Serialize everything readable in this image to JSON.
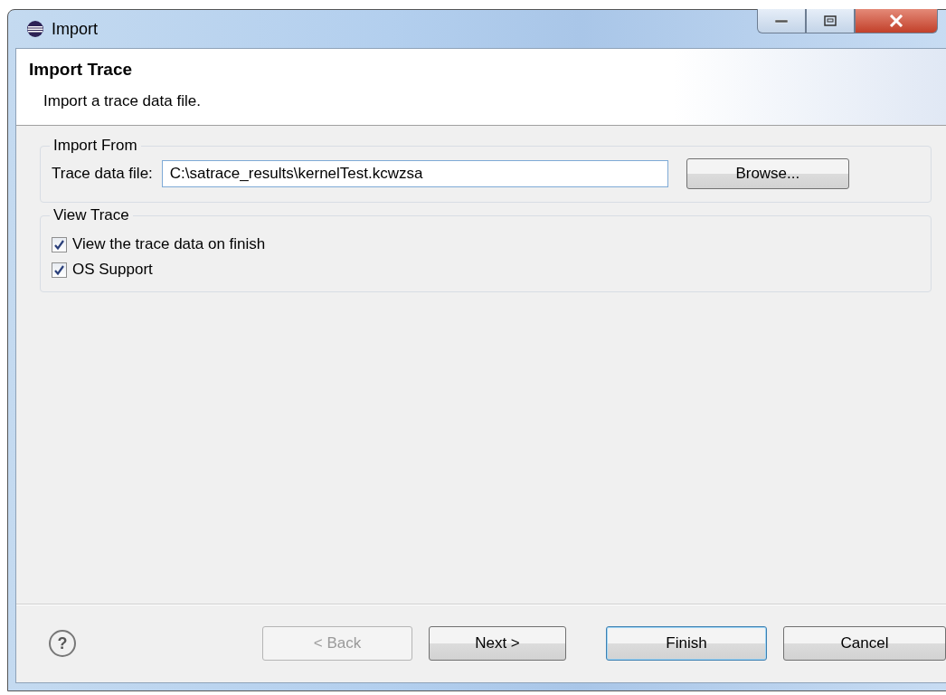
{
  "window": {
    "title": "Import"
  },
  "header": {
    "title": "Import Trace",
    "description": "Import a trace data file."
  },
  "import_from": {
    "legend": "Import From",
    "label": "Trace data file:",
    "value": "C:\\satrace_results\\kernelTest.kcwzsa",
    "browse": "Browse..."
  },
  "view_trace": {
    "legend": "View Trace",
    "options": [
      {
        "label": "View the trace data on finish",
        "checked": true
      },
      {
        "label": "OS Support",
        "checked": true
      }
    ]
  },
  "help": "?",
  "buttons": [
    {
      "label": "< Back",
      "disabled": true,
      "default": false
    },
    {
      "label": "Next >",
      "disabled": false,
      "default": false
    },
    {
      "label": "Finish",
      "disabled": false,
      "default": true
    },
    {
      "label": "Cancel",
      "disabled": false,
      "default": false
    }
  ]
}
